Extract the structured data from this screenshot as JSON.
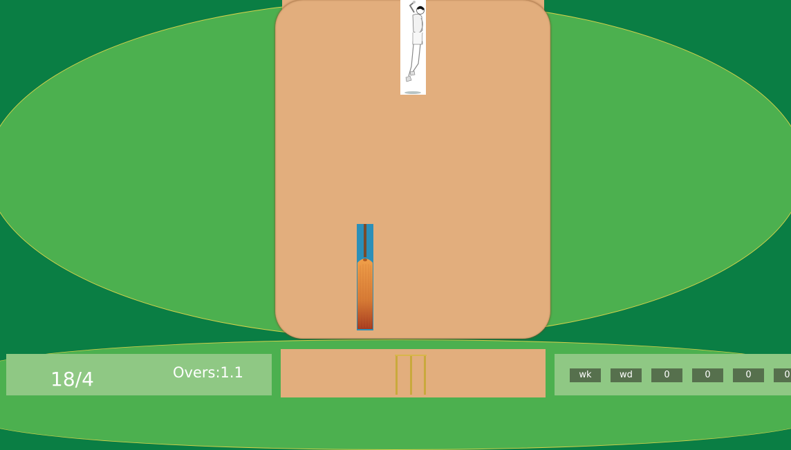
{
  "scoreboard": {
    "score": "18/4",
    "overs": "Overs:1.1"
  },
  "extras": {
    "chips": [
      "wk",
      "wd",
      "0",
      "0",
      "0",
      "0"
    ]
  },
  "colors": {
    "outfield_bg": "#0a7e44",
    "field": "#4cb04f",
    "boundary_line": "#d8d24a",
    "pitch": "#e2ae7d",
    "panel": "#8fc884",
    "chip": "#56704d",
    "bat_background": "#2c8fb8"
  },
  "icons": {
    "bowler": "bowler-sprite",
    "bat": "cricket-bat",
    "stumps": "wicket-stumps"
  }
}
